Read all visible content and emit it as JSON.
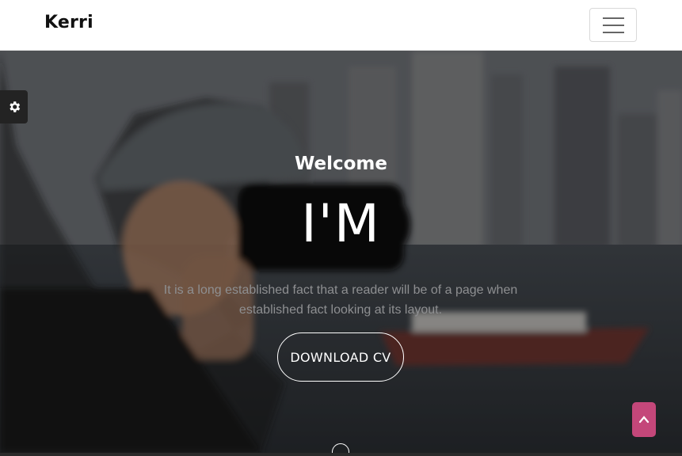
{
  "navbar": {
    "brand": "Kerri",
    "toggler_icon": "hamburger-menu-icon"
  },
  "hero": {
    "welcome": "Welcome",
    "headline": "I'M",
    "description": "It is a long established fact that a reader will be of a page when established fact looking at its layout.",
    "cta_label": "DOWNLOAD CV",
    "scroll_icon": "scroll-down-mouse-icon"
  },
  "widgets": {
    "settings_icon": "gear-icon",
    "back_to_top_icon": "chevron-up-icon",
    "back_to_top_color": "#c4477a"
  }
}
